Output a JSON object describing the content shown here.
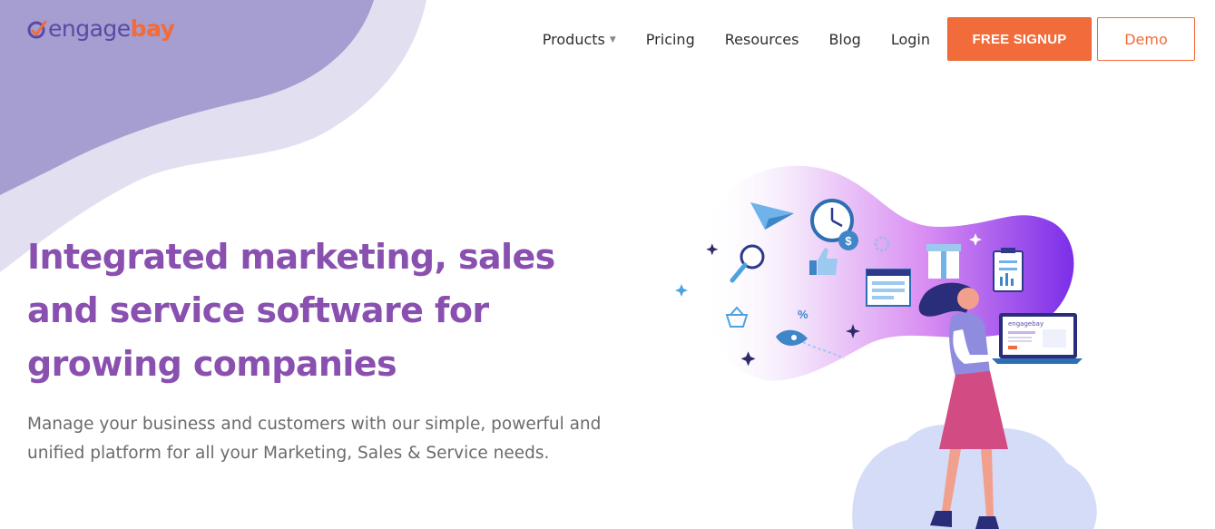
{
  "brand": {
    "logo_part1": "engage",
    "logo_part2": "bay",
    "primary_color": "#5b49a6",
    "accent_color": "#f26b3a"
  },
  "nav": {
    "items": [
      {
        "label": "Products",
        "has_dropdown": true
      },
      {
        "label": "Pricing"
      },
      {
        "label": "Resources"
      },
      {
        "label": "Blog"
      },
      {
        "label": "Login"
      }
    ],
    "signup_label": "FREE SIGNUP",
    "demo_label": "Demo"
  },
  "hero": {
    "title": "Integrated marketing, sales and service software for growing companies",
    "subtitle": "Manage your business and customers with our simple, powerful and unified platform for all your Marketing, Sales & Service needs.",
    "title_color": "#8a50b0"
  },
  "illustration": {
    "laptop_logo": "engagebay",
    "icons": [
      "paper-plane-icon",
      "clock-icon",
      "coins-icon",
      "gear-icon",
      "gift-icon",
      "clipboard-icon",
      "magnifier-icon",
      "thumbs-up-icon",
      "browser-window-icon",
      "basket-icon",
      "percent-icon",
      "rocket-icon",
      "sparkle-icon"
    ],
    "percent_symbol": "%"
  }
}
